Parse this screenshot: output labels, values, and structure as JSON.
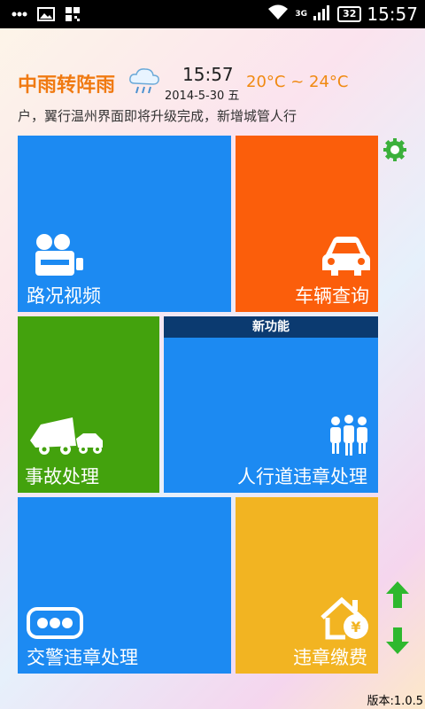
{
  "status_bar": {
    "time": "15:57",
    "battery": "32",
    "network": "3G"
  },
  "weather": {
    "condition": "中雨转阵雨",
    "time": "15:57",
    "date": "2014-5-30 五",
    "temperature": "20°C ~ 24°C"
  },
  "notice": "户，翼行温州界面即将升级完成，新增城管人行",
  "tiles": {
    "road_video": "路况视频",
    "vehicle_query": "车辆查询",
    "accident": "事故处理",
    "new_feature": "新功能",
    "pedestrian": "人行道违章处理",
    "police_violation": "交警违章处理",
    "fine_payment": "违章缴费"
  },
  "version": "版本:1.0.5",
  "colors": {
    "blue": "#1c8af2",
    "orange": "#fb5e0b",
    "green": "#43a20d",
    "yellow": "#f2b422",
    "navy": "#0b3a70"
  }
}
